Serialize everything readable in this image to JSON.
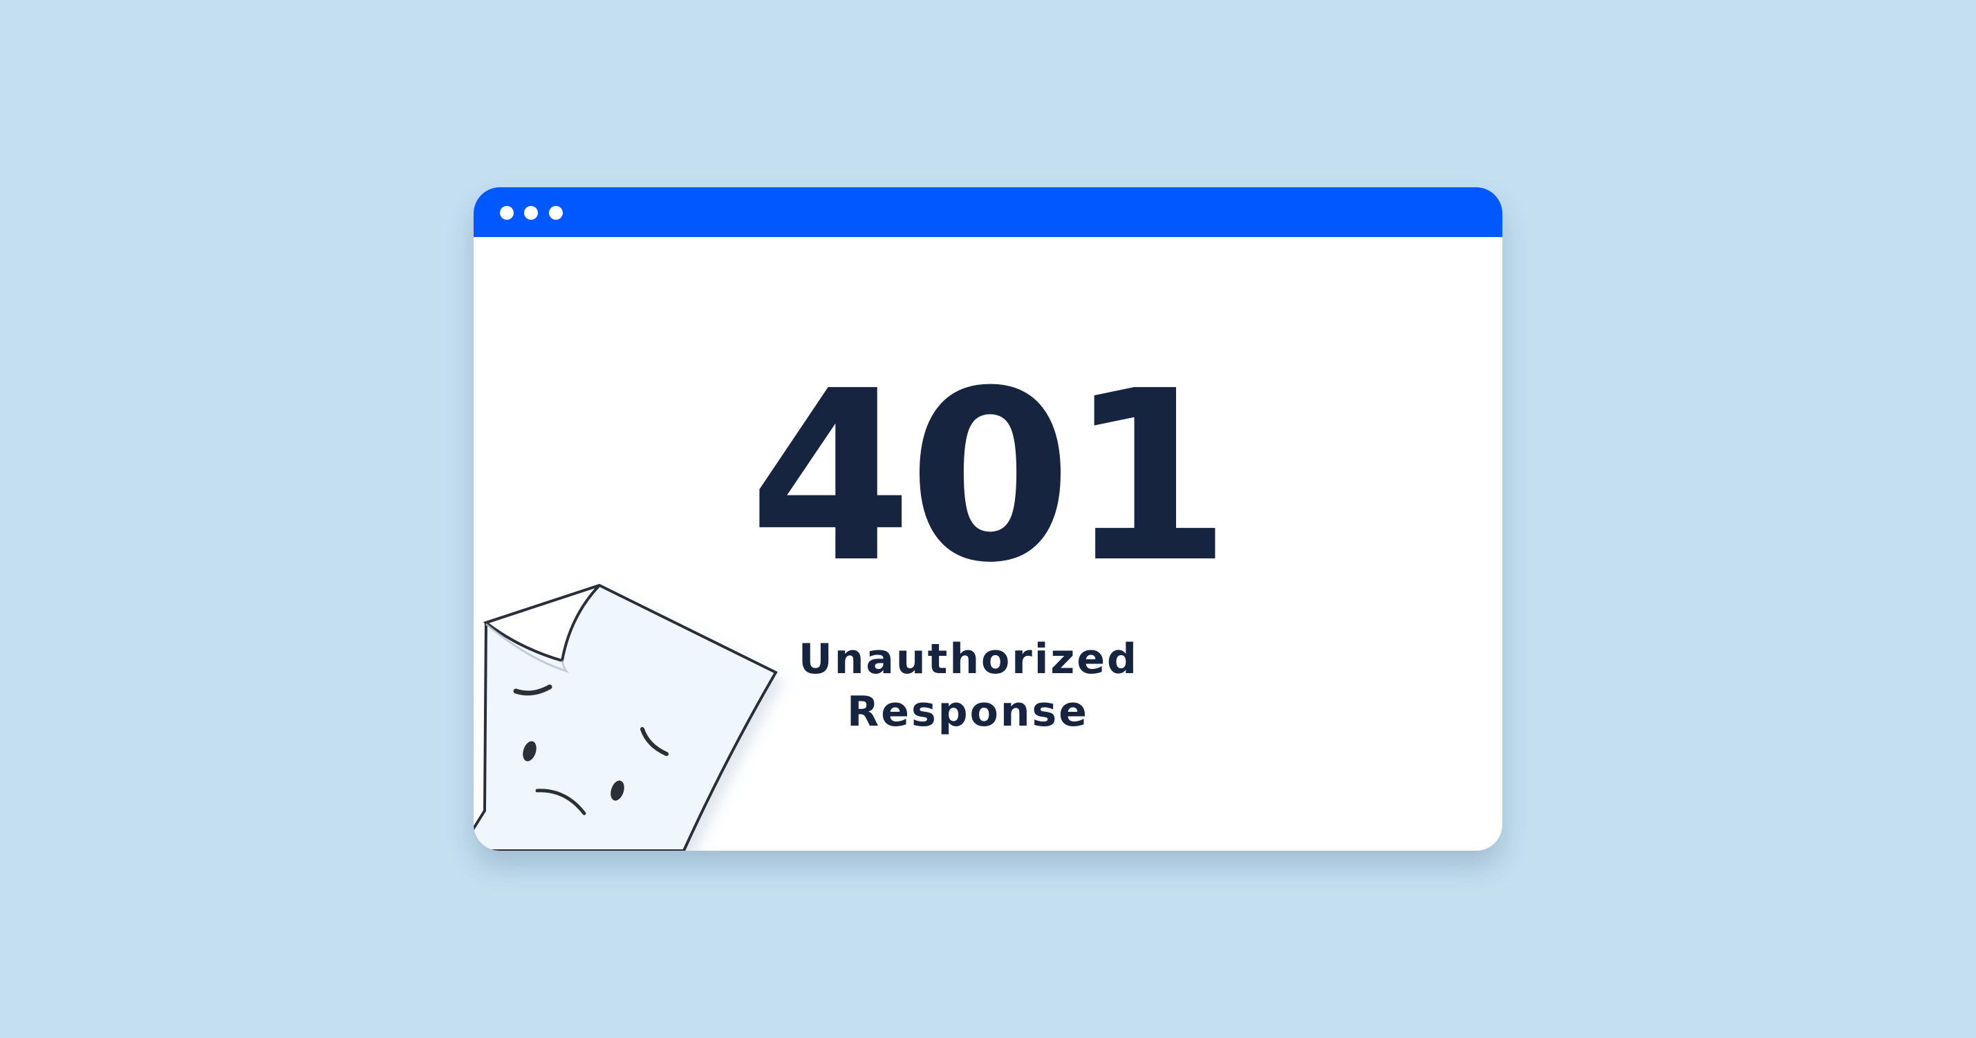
{
  "error": {
    "code": "401",
    "message_line_1": "Unauthorized",
    "message_line_2": "Response"
  },
  "colors": {
    "background": "#c4dff0",
    "window": "#ffffff",
    "title_bar": "#0158ff",
    "text": "#16243f",
    "document_fill": "#f0f6fe",
    "document_outline": "#2b2f3a"
  },
  "illustration": {
    "icon": "sad-document-icon"
  }
}
